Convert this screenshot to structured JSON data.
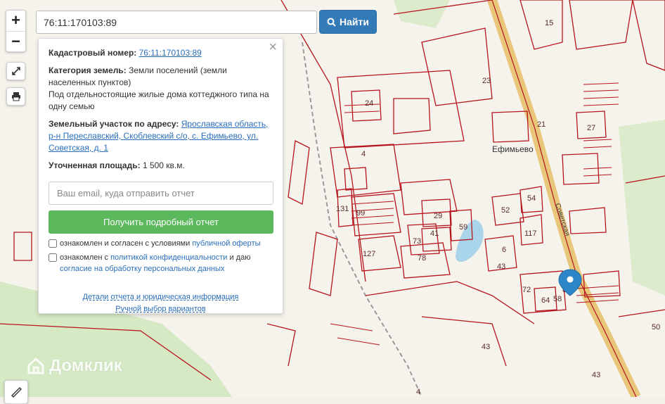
{
  "map": {
    "zoom_in": "+",
    "zoom_out": "−",
    "village": "Ефимьево",
    "street": "Советская",
    "plot_labels": [
      "15",
      "23",
      "24",
      "21",
      "27",
      "4",
      "131",
      "99",
      "29",
      "59",
      "52",
      "54",
      "117",
      "73",
      "41",
      "127",
      "78",
      "6",
      "43",
      "72",
      "8",
      "64",
      "58",
      "43",
      "50",
      "43",
      "4"
    ],
    "colors": {
      "boundary": "#b5141c",
      "road": "#e8c77a",
      "forest": "#d6e9c5",
      "water": "#a9d4ea",
      "marker": "#2e86c9"
    }
  },
  "search": {
    "value": "76:11:170103:89",
    "button_label": "Найти"
  },
  "panel": {
    "close": "×",
    "cadastral_label": "Кадастровый номер:",
    "cadastral_value": "76:11:170103:89",
    "category_label": "Категория земель:",
    "category_value": "Земли поселений (земли населенных пунктов)",
    "category_detail": "Под отдельностоящие жилые дома коттеджного типа на одну семью",
    "address_label": "Земельный участок по адресу:",
    "address_value": "Ярославская область, р-н Переславский, Скоблевский с/о, с. Ефимьево, ул. Советская, д. 1",
    "area_label": "Уточненная площадь:",
    "area_value": "1 500 кв.м.",
    "email_placeholder": "Ваш email, куда отправить отчет",
    "report_button": "Получить подробный отчет",
    "consent1_text": "ознакомлен и согласен с условиями",
    "consent1_link": "публичной оферты",
    "consent2_text": "ознакомлен с",
    "consent2_link": "политикой конфиденциальности",
    "consent2_mid": "и даю",
    "consent2_link2": "согласие на обработку персональных данных",
    "details_link": "Детали отчета и юридическая информация",
    "manual_link": "Ручной выбор вариантов"
  },
  "watermark": "Домклик"
}
